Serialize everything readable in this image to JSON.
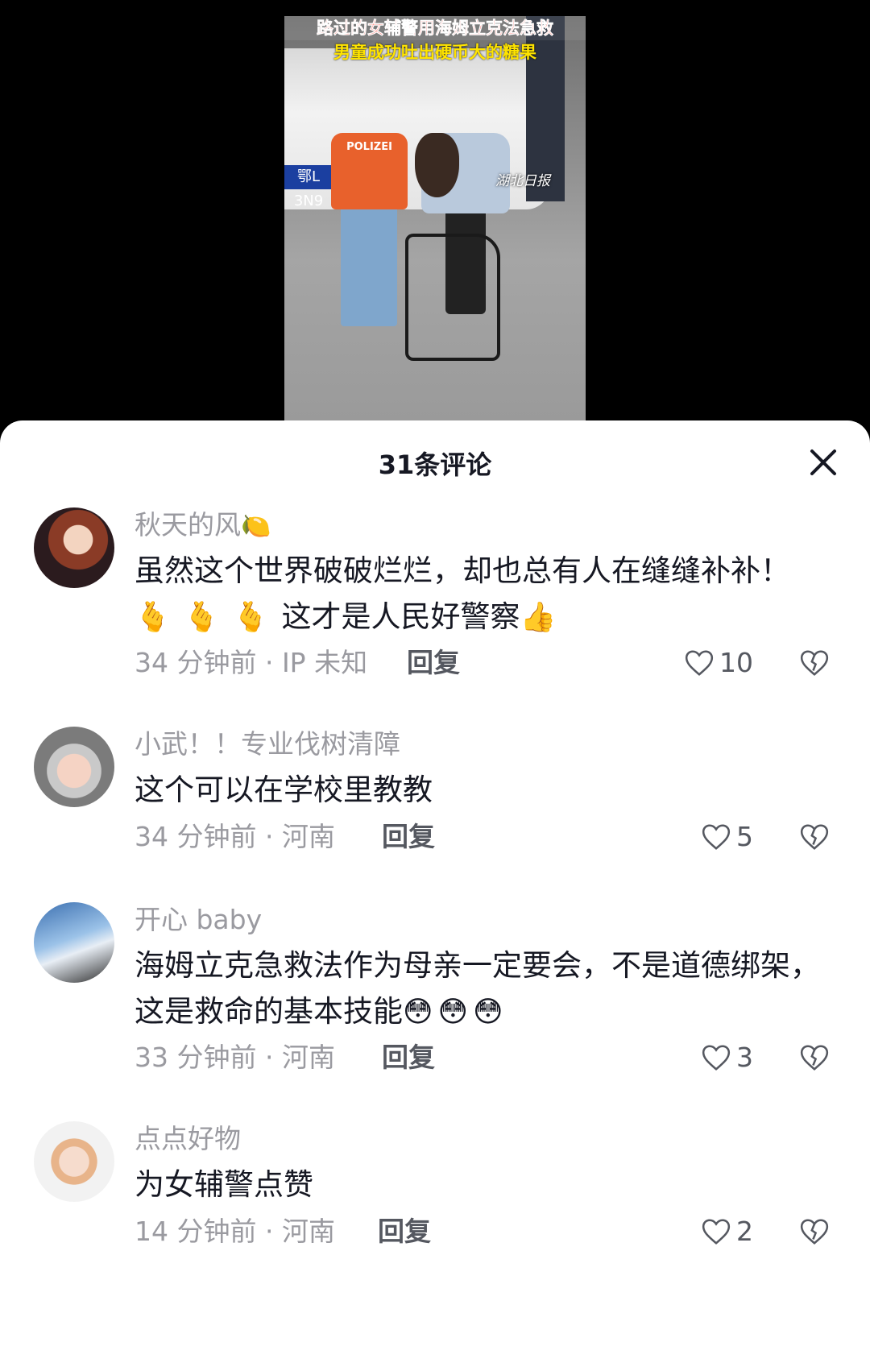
{
  "video": {
    "caption_line1": "路过的女辅警用海姆立克法急救",
    "caption_line2": "男童成功吐出硬币大的糖果",
    "watermark": "湖北日报",
    "plate_text": "鄂L 3N9",
    "jacket_text": "POLIZEI"
  },
  "sheet": {
    "title": "31条评论"
  },
  "comments": [
    {
      "user": "秋天的风",
      "user_emoji": "🍋",
      "text_part1": "虽然这个世界破破烂烂，却也总有人在缝缝补补！",
      "emojis_mid": "🫰🫰🫰",
      "text_part2": "这才是人民好警察",
      "emoji_end": "👍",
      "time": "34 分钟前 · IP 未知",
      "reply": "回复",
      "likes": "10"
    },
    {
      "user": "小武！！专业伐树清障",
      "text": "这个可以在学校里教教",
      "time": "34 分钟前 · 河南",
      "reply": "回复",
      "likes": "5"
    },
    {
      "user": "开心 baby",
      "text_part1": "海姆立克急救法作为母亲一定要会，不是道德绑架，这是救命的基本技能",
      "emoji_end": "😳😳😳",
      "time": "33 分钟前 · 河南",
      "reply": "回复",
      "likes": "3"
    },
    {
      "user": "点点好物",
      "text": "为女辅警点赞",
      "time": "14 分钟前 · 河南",
      "reply": "回复",
      "likes": "2"
    }
  ],
  "colors": {
    "text_primary": "#161823",
    "text_secondary": "#9a9aa0"
  }
}
